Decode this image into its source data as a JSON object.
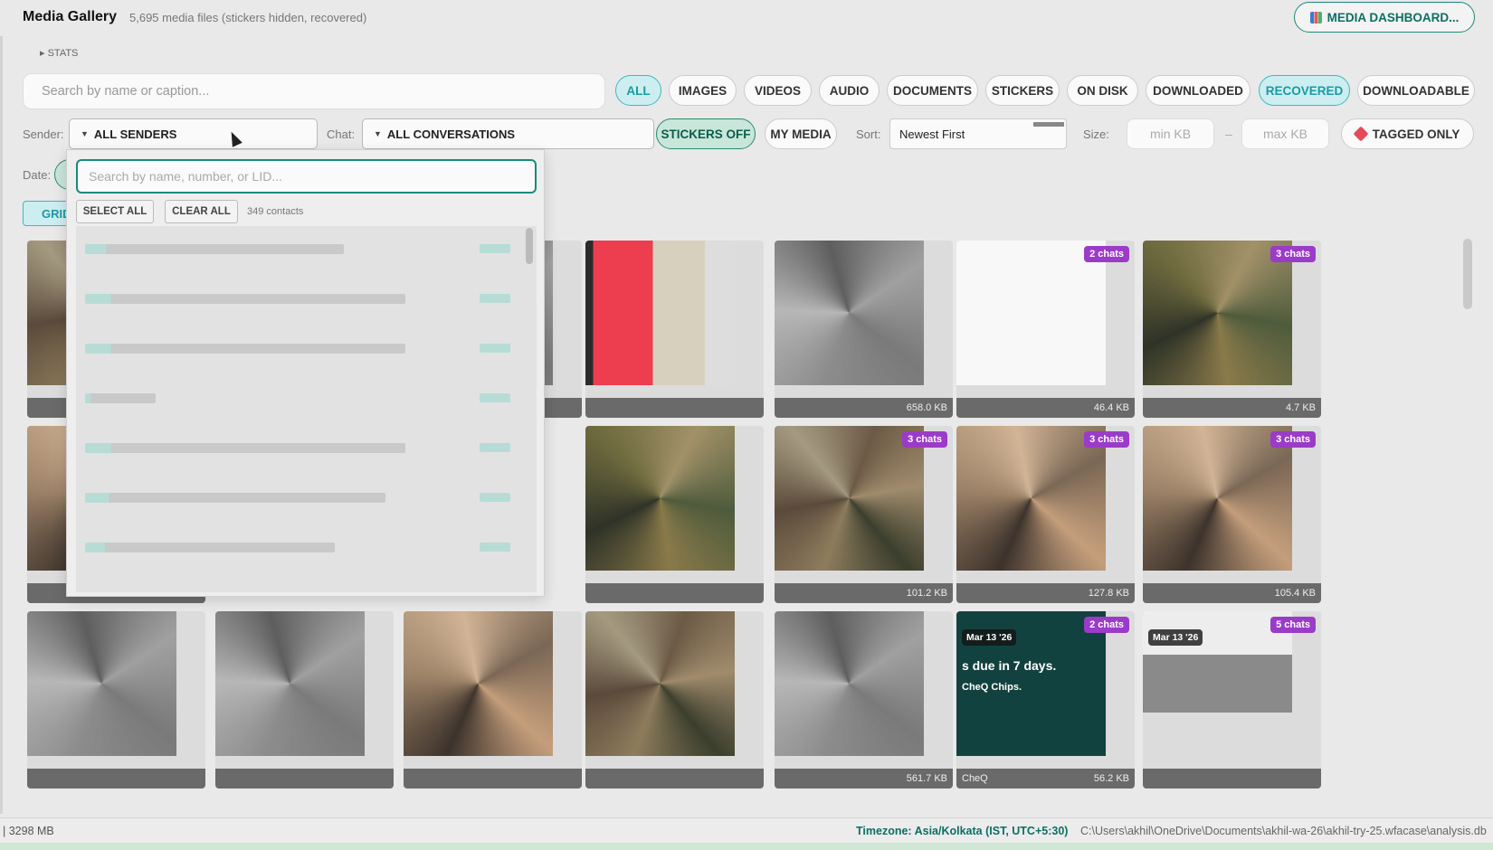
{
  "header": {
    "title": "Media Gallery",
    "subtitle": "5,695 media files  (stickers hidden, recovered)",
    "dashboard_button": "MEDIA DASHBOARD...",
    "stats_toggle": "▸ STATS"
  },
  "search": {
    "placeholder": "Search by name or caption..."
  },
  "type_filters": [
    "ALL",
    "IMAGES",
    "VIDEOS",
    "AUDIO",
    "DOCUMENTS",
    "STICKERS",
    "ON DISK",
    "DOWNLOADED",
    "RECOVERED",
    "DOWNLOADABLE"
  ],
  "active_type_filters": [
    "ALL",
    "RECOVERED"
  ],
  "filters": {
    "sender_label": "Sender:",
    "sender_value": "ALL SENDERS",
    "chat_label": "Chat:",
    "chat_value": "ALL CONVERSATIONS",
    "stickers_toggle": "STICKERS OFF",
    "my_media": "MY MEDIA",
    "sort_label": "Sort:",
    "sort_value": "Newest First",
    "size_label": "Size:",
    "size_min_placeholder": "min KB",
    "size_max_placeholder": "max KB",
    "size_dash": "–",
    "tagged_only": "TAGGED ONLY",
    "date_label": "Date:",
    "view_grid": "GRID"
  },
  "sender_dropdown": {
    "search_placeholder": "Search by name, number, or LID...",
    "select_all": "SELECT ALL",
    "clear_all": "CLEAR ALL",
    "count": "349 contacts"
  },
  "cards": [
    {
      "chats": "",
      "size": "",
      "date": "",
      "caption": ""
    },
    {
      "chats": "",
      "size": "",
      "date": "",
      "caption": ""
    },
    {
      "chats": "",
      "size": "",
      "date": "",
      "caption": ""
    },
    {
      "chats": "",
      "size": "",
      "date": "",
      "caption": ""
    },
    {
      "chats": "",
      "size": "658.0 KB",
      "date": "",
      "caption": ""
    },
    {
      "chats": "2 chats",
      "size": "46.4 KB",
      "date": "",
      "caption": ""
    },
    {
      "chats": "3 chats",
      "size": "4.7 KB",
      "date": "",
      "caption": ""
    },
    {
      "chats": "3 chats",
      "size": "101.2 KB",
      "date": "",
      "caption": ""
    },
    {
      "chats": "3 chats",
      "size": "127.8 KB",
      "date": "",
      "caption": ""
    },
    {
      "chats": "3 chats",
      "size": "105.4 KB",
      "date": "",
      "caption": ""
    },
    {
      "chats": "2 chats",
      "size": "56.2 KB",
      "date": "Mar 13 '26",
      "caption": "CheQ"
    },
    {
      "chats": "5 chats",
      "size": "",
      "date": "Mar 13 '26",
      "caption": ""
    },
    {
      "chats": "",
      "size": "561.7 KB",
      "date": "",
      "caption": ""
    }
  ],
  "cheq_card": {
    "headline": "s due in 7 days.",
    "sub": "CheQ Chips."
  },
  "statusbar": {
    "size": "| 3298 MB",
    "timezone": "Timezone: Asia/Kolkata (IST, UTC+5:30)",
    "path": "C:\\Users\\akhil\\OneDrive\\Documents\\akhil-wa-26\\akhil-try-25.wfacase\\analysis.db"
  },
  "colors": {
    "accent": "#1a8a7a",
    "recovered": "#1a9aa5",
    "chats_badge": "#9a3cc7",
    "tagged": "#e34b5b"
  },
  "icons": {
    "dashboard": "bar-chart-icon",
    "tagged": "tag-icon",
    "dropdown": "caret-down-icon"
  }
}
